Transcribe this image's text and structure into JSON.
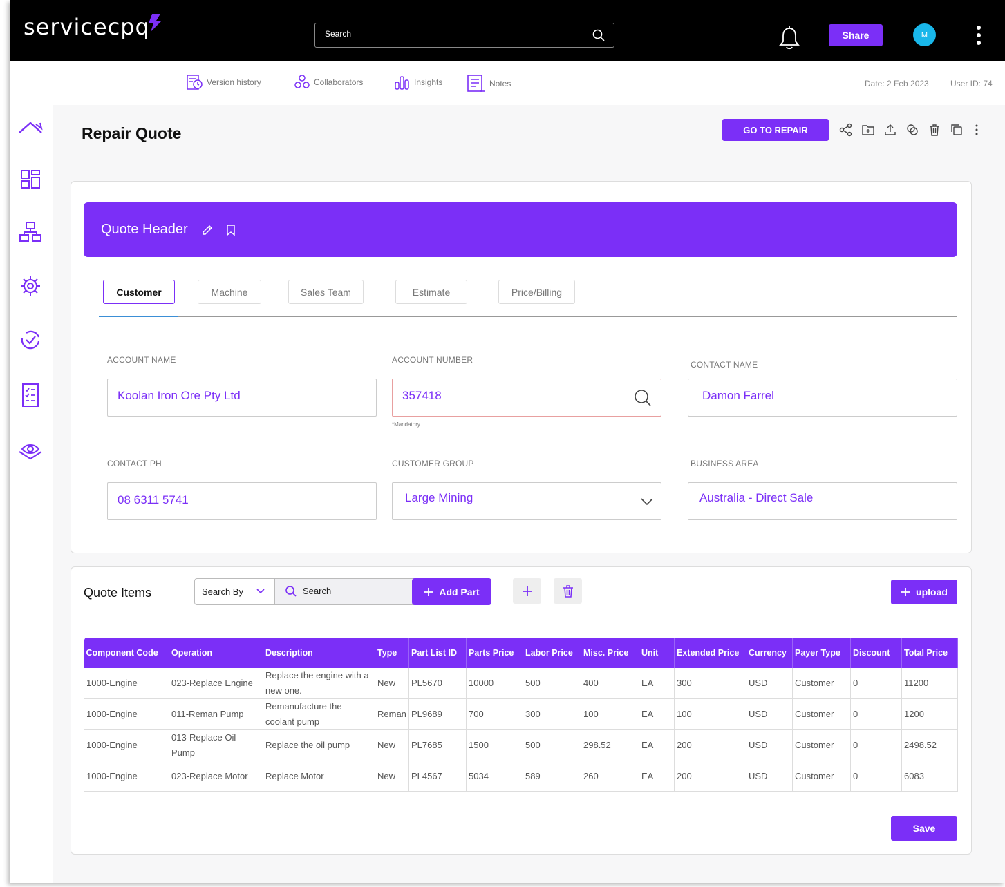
{
  "brand": {
    "name": "servicecpq",
    "accent": "#7b2ff7"
  },
  "topbar": {
    "search_placeholder": "Search",
    "share_label": "Share",
    "avatar_initial": "M"
  },
  "subbar": {
    "items": [
      {
        "label": "Version history",
        "icon": "version-history-icon"
      },
      {
        "label": "Collaborators",
        "icon": "collaborators-icon"
      },
      {
        "label": "Insights",
        "icon": "insights-icon"
      },
      {
        "label": "Notes",
        "icon": "notes-icon"
      }
    ],
    "date": "Date: 2 Feb 2023",
    "user_id": "User ID: 74"
  },
  "page": {
    "title": "Repair Quote",
    "go_to_repair_label": "GO TO REPAIR"
  },
  "quote_header": {
    "title": "Quote Header",
    "tabs": [
      "Customer",
      "Machine",
      "Sales Team",
      "Estimate",
      "Price/Billing"
    ],
    "active_tab": "Customer",
    "fields": {
      "account_name": {
        "label": "ACCOUNT NAME",
        "value": "Koolan Iron Ore Pty Ltd"
      },
      "account_number": {
        "label": "ACCOUNT NUMBER",
        "value": "357418",
        "note": "*Mandatory"
      },
      "contact_name": {
        "label": "CONTACT NAME",
        "value": "Damon Farrel"
      },
      "contact_ph": {
        "label": "CONTACT PH",
        "value": "08 6311 5741"
      },
      "customer_group": {
        "label": "CUSTOMER GROUP",
        "value": "Large Mining"
      },
      "business_area": {
        "label": "BUSINESS AREA",
        "value": "Australia - Direct Sale"
      }
    }
  },
  "quote_items": {
    "title": "Quote Items",
    "search_by_label": "Search By",
    "search_placeholder": "Search",
    "add_part_label": "Add Part",
    "upload_label": "upload",
    "save_label": "Save",
    "columns": [
      "Component Code",
      "Operation",
      "Description",
      "Type",
      "Part List ID",
      "Parts Price",
      "Labor Price",
      "Misc. Price",
      "Unit",
      "Extended Price",
      "Currency",
      "Payer Type",
      "Discount",
      "Total Price"
    ],
    "rows": [
      [
        "1000-Engine",
        "023-Replace Engine",
        "Replace the engine with a new one.",
        "New",
        "PL5670",
        "10000",
        "500",
        "400",
        "EA",
        "300",
        "USD",
        "Customer",
        "0",
        "11200"
      ],
      [
        "1000-Engine",
        "011-Reman Pump",
        "Remanufacture the coolant pump",
        "Reman",
        "PL9689",
        "700",
        "300",
        "100",
        "EA",
        "100",
        "USD",
        "Customer",
        "0",
        "1200"
      ],
      [
        "1000-Engine",
        "013-Replace Oil Pump",
        "Replace the oil pump",
        "New",
        "PL7685",
        "1500",
        "500",
        "298.52",
        "EA",
        "200",
        "USD",
        "Customer",
        "0",
        "2498.52"
      ],
      [
        "1000-Engine",
        "023-Replace Motor",
        "Replace Motor",
        "New",
        "PL4567",
        "5034",
        "589",
        "260",
        "EA",
        "200",
        "USD",
        "Customer",
        "0",
        "6083"
      ]
    ]
  }
}
